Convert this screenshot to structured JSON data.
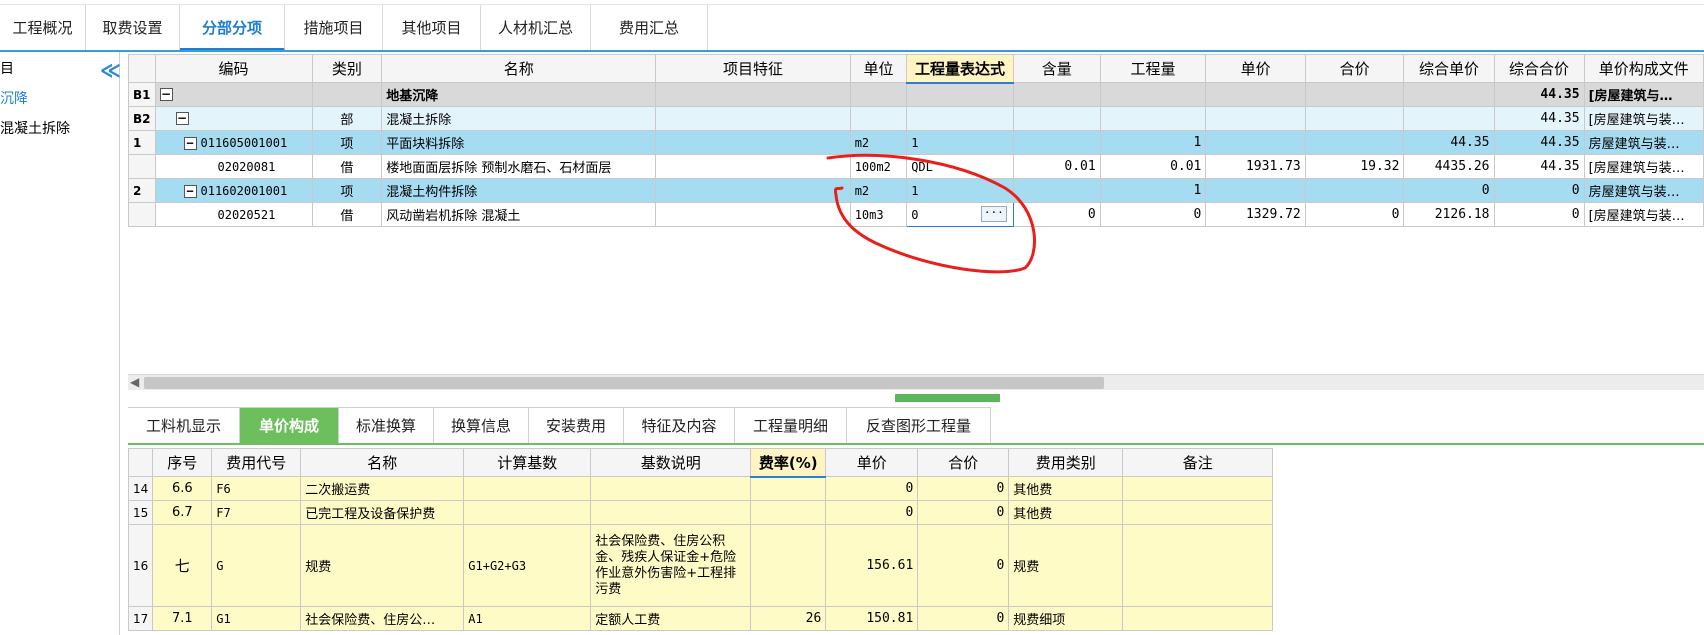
{
  "top_tabs": [
    "工程概况",
    "取费设置",
    "分部分项",
    "措施项目",
    "其他项目",
    "人材机汇总",
    "费用汇总"
  ],
  "left_tree": {
    "items": [
      "目",
      "沉降",
      "混凝土拆除"
    ],
    "collapse_glyph": "≪"
  },
  "grid": {
    "headers": [
      "编码",
      "类别",
      "名称",
      "项目特征",
      "单位",
      "工程量表达式",
      "含量",
      "工程量",
      "单价",
      "合价",
      "综合单价",
      "综合合价",
      "单价构成文件"
    ],
    "rows": [
      {
        "no": "B1",
        "code": "",
        "type": "",
        "name": "地基沉降",
        "feature": "",
        "unit": "",
        "expr": "",
        "content": "",
        "qty": "",
        "price": "",
        "total": "",
        "unit_total": "",
        "comp_total": "44.35",
        "file": "[房屋建筑与…"
      },
      {
        "no": "B2",
        "code": "",
        "type": "部",
        "name": "混凝土拆除",
        "feature": "",
        "unit": "",
        "expr": "",
        "content": "",
        "qty": "",
        "price": "",
        "total": "",
        "unit_total": "",
        "comp_total": "44.35",
        "file": "[房屋建筑与装…"
      },
      {
        "no": "1",
        "code": "011605001001",
        "type": "项",
        "name": "平面块料拆除",
        "feature": "",
        "unit": "m2",
        "expr": "1",
        "content": "",
        "qty": "1",
        "price": "",
        "total": "",
        "unit_total": "44.35",
        "comp_total": "44.35",
        "file": "房屋建筑与装…"
      },
      {
        "no": "",
        "code": "02020081",
        "type": "借",
        "name": "楼地面面层拆除 预制水磨石、石材面层",
        "feature": "",
        "unit": "100m2",
        "expr": "QDL",
        "content": "0.01",
        "qty": "0.01",
        "price": "1931.73",
        "total": "19.32",
        "unit_total": "4435.26",
        "comp_total": "44.35",
        "file": "[房屋建筑与装…"
      },
      {
        "no": "2",
        "code": "011602001001",
        "type": "项",
        "name": "混凝土构件拆除",
        "feature": "",
        "unit": "m2",
        "expr": "1",
        "content": "",
        "qty": "1",
        "price": "",
        "total": "",
        "unit_total": "0",
        "comp_total": "0",
        "file": "房屋建筑与装…"
      },
      {
        "no": "",
        "code": "02020521",
        "type": "借",
        "name": "风动凿岩机拆除 混凝土",
        "feature": "",
        "unit": "10m3",
        "expr": "0",
        "content": "0",
        "qty": "0",
        "price": "1329.72",
        "total": "0",
        "unit_total": "2126.18",
        "comp_total": "0",
        "file": "[房屋建筑与装…"
      }
    ],
    "edit_button_label": "···"
  },
  "bottom_tabs": [
    "工料机显示",
    "单价构成",
    "标准换算",
    "换算信息",
    "安装费用",
    "特征及内容",
    "工程量明细",
    "反查图形工程量"
  ],
  "detail_grid": {
    "headers": [
      "序号",
      "费用代号",
      "名称",
      "计算基数",
      "基数说明",
      "费率(%)",
      "单价",
      "合价",
      "费用类别",
      "备注"
    ],
    "rows": [
      {
        "no": "14",
        "seq": "6.6",
        "code": "F6",
        "name": "二次搬运费",
        "base": "",
        "desc": "",
        "rate": "",
        "price": "0",
        "total": "0",
        "cat": "其他费",
        "note": ""
      },
      {
        "no": "15",
        "seq": "6.7",
        "code": "F7",
        "name": "已完工程及设备保护费",
        "base": "",
        "desc": "",
        "rate": "",
        "price": "0",
        "total": "0",
        "cat": "其他费",
        "note": ""
      },
      {
        "no": "16",
        "seq": "七",
        "code": "G",
        "name": "规费",
        "base": "G1+G2+G3",
        "desc": "社会保险费、住房公积金、残疾人保证金+危险作业意外伤害险+工程排污费",
        "rate": "",
        "price": "156.61",
        "total": "0",
        "cat": "规费",
        "note": ""
      },
      {
        "no": "17",
        "seq": "7.1",
        "code": "G1",
        "name": "社会保险费、住房公…",
        "base": "A1",
        "desc": "定额人工费",
        "rate": "26",
        "price": "150.81",
        "total": "0",
        "cat": "规费细项",
        "note": ""
      }
    ]
  },
  "colors": {
    "accent_blue": "#1e7fd0",
    "active_green": "#6cbf5c",
    "item_row_blue": "#a6dcf2",
    "detail_yellow": "#fffbc7",
    "annotation_red": "#e8201c"
  }
}
